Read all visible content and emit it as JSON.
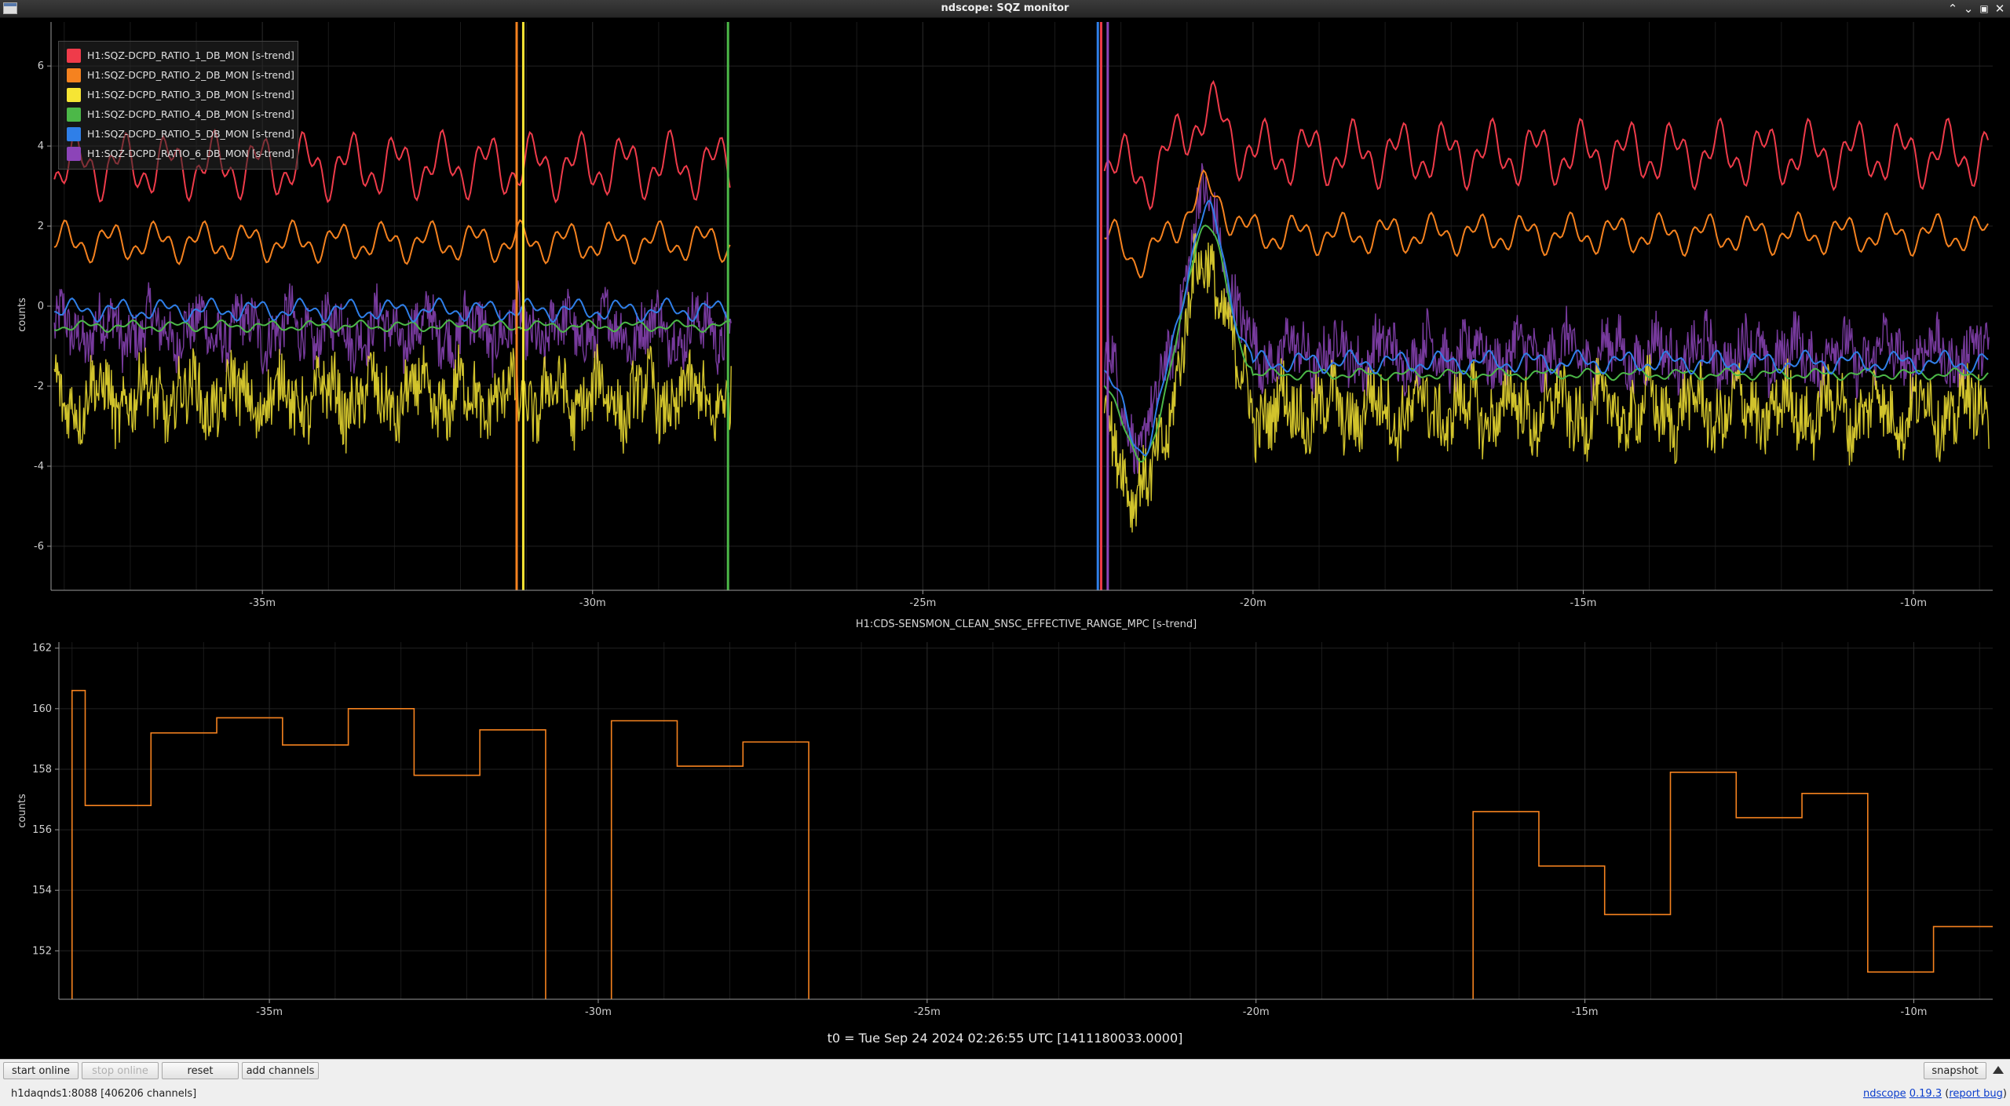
{
  "window": {
    "title": "ndscope: SQZ monitor"
  },
  "top_plot": {
    "ylabel": "counts",
    "legend": [
      {
        "label": "H1:SQZ-DCPD_RATIO_1_DB_MON [s-trend]",
        "color": "#ef3b4a"
      },
      {
        "label": "H1:SQZ-DCPD_RATIO_2_DB_MON [s-trend]",
        "color": "#f5821f"
      },
      {
        "label": "H1:SQZ-DCPD_RATIO_3_DB_MON [s-trend]",
        "color": "#f6e534"
      },
      {
        "label": "H1:SQZ-DCPD_RATIO_4_DB_MON [s-trend]",
        "color": "#4cb848"
      },
      {
        "label": "H1:SQZ-DCPD_RATIO_5_DB_MON [s-trend]",
        "color": "#2f7fe8"
      },
      {
        "label": "H1:SQZ-DCPD_RATIO_6_DB_MON [s-trend]",
        "color": "#8c44b8"
      }
    ]
  },
  "bottom_plot": {
    "title": "H1:CDS-SENSMON_CLEAN_SNSC_EFFECTIVE_RANGE_MPC [s-trend]",
    "ylabel": "counts"
  },
  "chart_data": [
    {
      "type": "line",
      "title": "",
      "xlabel": "",
      "ylabel": "counts",
      "xlim": [
        -38.2,
        -8.8
      ],
      "ylim": [
        -7.1,
        7.1
      ],
      "x_ticks": [
        -35,
        -30,
        -25,
        -20,
        -15,
        -10
      ],
      "x_tick_labels": [
        "-35m",
        "-30m",
        "-25m",
        "-20m",
        "-15m",
        "-10m"
      ],
      "y_ticks": [
        -6,
        -4,
        -2,
        0,
        2,
        4,
        6
      ],
      "y_tick_labels": [
        "-6",
        "-4",
        "-2",
        "0",
        "2",
        "4",
        "6"
      ],
      "grid": true,
      "legend_position": "top-left",
      "gap": [
        -27.9,
        -22.3
      ],
      "series": [
        {
          "name": "H1:SQZ-DCPD_RATIO_1_DB_MON [s-trend]",
          "color": "#ef3b4a",
          "mean_before": 3.5,
          "mean_after": 3.8,
          "amp": 0.9
        },
        {
          "name": "H1:SQZ-DCPD_RATIO_2_DB_MON [s-trend]",
          "color": "#f5821f",
          "mean_before": 1.6,
          "mean_after": 1.8,
          "amp": 0.55
        },
        {
          "name": "H1:SQZ-DCPD_RATIO_3_DB_MON [s-trend]",
          "color": "#f6e534",
          "mean_before": -2.3,
          "mean_after": -2.6,
          "amp": 0.7
        },
        {
          "name": "H1:SQZ-DCPD_RATIO_4_DB_MON [s-trend]",
          "color": "#4cb848",
          "mean_before": -0.5,
          "mean_after": -1.7,
          "amp": 0.15
        },
        {
          "name": "H1:SQZ-DCPD_RATIO_5_DB_MON [s-trend]",
          "color": "#2f7fe8",
          "mean_before": -0.1,
          "mean_after": -1.4,
          "amp": 0.3
        },
        {
          "name": "H1:SQZ-DCPD_RATIO_6_DB_MON [s-trend]",
          "color": "#8c44b8",
          "mean_before": -0.6,
          "mean_after": -1.2,
          "amp": 0.6
        }
      ]
    },
    {
      "type": "line",
      "title": "H1:CDS-SENSMON_CLEAN_SNSC_EFFECTIVE_RANGE_MPC [s-trend]",
      "xlabel": "",
      "ylabel": "counts",
      "xlim": [
        -38.2,
        -8.8
      ],
      "ylim": [
        150.4,
        162.2
      ],
      "x_ticks": [
        -35,
        -30,
        -25,
        -20,
        -15,
        -10
      ],
      "x_tick_labels": [
        "-35m",
        "-30m",
        "-25m",
        "-20m",
        "-15m",
        "-10m"
      ],
      "y_ticks": [
        152,
        154,
        156,
        158,
        160,
        162
      ],
      "y_tick_labels": [
        "152",
        "154",
        "156",
        "158",
        "160",
        "162"
      ],
      "grid": true,
      "color": "#f5821f",
      "steps": [
        {
          "x0": -38.0,
          "x1": -37.8,
          "y": 160.6
        },
        {
          "x0": -37.8,
          "x1": -36.8,
          "y": 156.8
        },
        {
          "x0": -36.8,
          "x1": -35.8,
          "y": 159.2
        },
        {
          "x0": -35.8,
          "x1": -34.8,
          "y": 159.7
        },
        {
          "x0": -34.8,
          "x1": -33.8,
          "y": 158.8
        },
        {
          "x0": -33.8,
          "x1": -32.8,
          "y": 160.0
        },
        {
          "x0": -32.8,
          "x1": -31.8,
          "y": 157.8
        },
        {
          "x0": -31.8,
          "x1": -30.8,
          "y": 159.3
        },
        {
          "x0": -29.8,
          "x1": -28.8,
          "y": 159.6
        },
        {
          "x0": -28.8,
          "x1": -27.8,
          "y": 158.1
        },
        {
          "x0": -27.8,
          "x1": -26.8,
          "y": 158.9
        },
        {
          "x0": -16.7,
          "x1": -15.7,
          "y": 156.6
        },
        {
          "x0": -15.7,
          "x1": -14.7,
          "y": 154.8
        },
        {
          "x0": -14.7,
          "x1": -13.7,
          "y": 153.2
        },
        {
          "x0": -13.7,
          "x1": -12.7,
          "y": 157.9
        },
        {
          "x0": -12.7,
          "x1": -11.7,
          "y": 156.4
        },
        {
          "x0": -11.7,
          "x1": -10.7,
          "y": 157.2
        },
        {
          "x0": -10.7,
          "x1": -9.7,
          "y": 151.3
        },
        {
          "x0": -9.7,
          "x1": -8.8,
          "y": 152.8
        }
      ]
    }
  ],
  "t0_text": "t0 = Tue Sep 24 2024 02:26:55 UTC [1411180033.0000]",
  "toolbar": {
    "start_online": "start online",
    "stop_online": "stop online",
    "reset": "reset",
    "add_channels": "add channels",
    "snapshot": "snapshot"
  },
  "status": {
    "server": "h1daqnds1:8088  [406206 channels]",
    "app_link": "ndscope",
    "version_link": "0.19.3",
    "report_bug_link": "report bug"
  }
}
